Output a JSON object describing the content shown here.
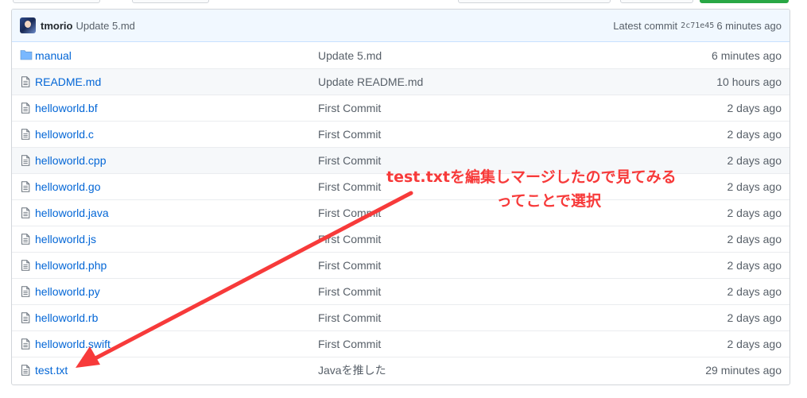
{
  "latest_commit": {
    "user": "tmorio",
    "message": "Update 5.md",
    "label": "Latest commit",
    "sha": "2c71e45",
    "age": "6 minutes ago"
  },
  "files": [
    {
      "type": "folder",
      "name": "manual",
      "message": "Update 5.md",
      "age": "6 minutes ago"
    },
    {
      "type": "file",
      "name": "README.md",
      "message": "Update README.md",
      "age": "10 hours ago"
    },
    {
      "type": "file",
      "name": "helloworld.bf",
      "message": "First Commit",
      "age": "2 days ago"
    },
    {
      "type": "file",
      "name": "helloworld.c",
      "message": "First Commit",
      "age": "2 days ago"
    },
    {
      "type": "file",
      "name": "helloworld.cpp",
      "message": "First Commit",
      "age": "2 days ago"
    },
    {
      "type": "file",
      "name": "helloworld.go",
      "message": "First Commit",
      "age": "2 days ago"
    },
    {
      "type": "file",
      "name": "helloworld.java",
      "message": "First Commit",
      "age": "2 days ago"
    },
    {
      "type": "file",
      "name": "helloworld.js",
      "message": "First Commit",
      "age": "2 days ago"
    },
    {
      "type": "file",
      "name": "helloworld.php",
      "message": "First Commit",
      "age": "2 days ago"
    },
    {
      "type": "file",
      "name": "helloworld.py",
      "message": "First Commit",
      "age": "2 days ago"
    },
    {
      "type": "file",
      "name": "helloworld.rb",
      "message": "First Commit",
      "age": "2 days ago"
    },
    {
      "type": "file",
      "name": "helloworld.swift",
      "message": "First Commit",
      "age": "2 days ago"
    },
    {
      "type": "file",
      "name": "test.txt",
      "message": "Javaを推した",
      "age": "29 minutes ago"
    }
  ],
  "annotation": {
    "line1": "test.txtを編集しマージしたので見てみる",
    "line2": "ってことで選択",
    "color": "#f73a3a"
  },
  "colors": {
    "link": "#0366d6",
    "muted": "#586069",
    "commit_bar_bg": "#f1f8ff",
    "hover_row_bg": "#f6f8fa"
  }
}
